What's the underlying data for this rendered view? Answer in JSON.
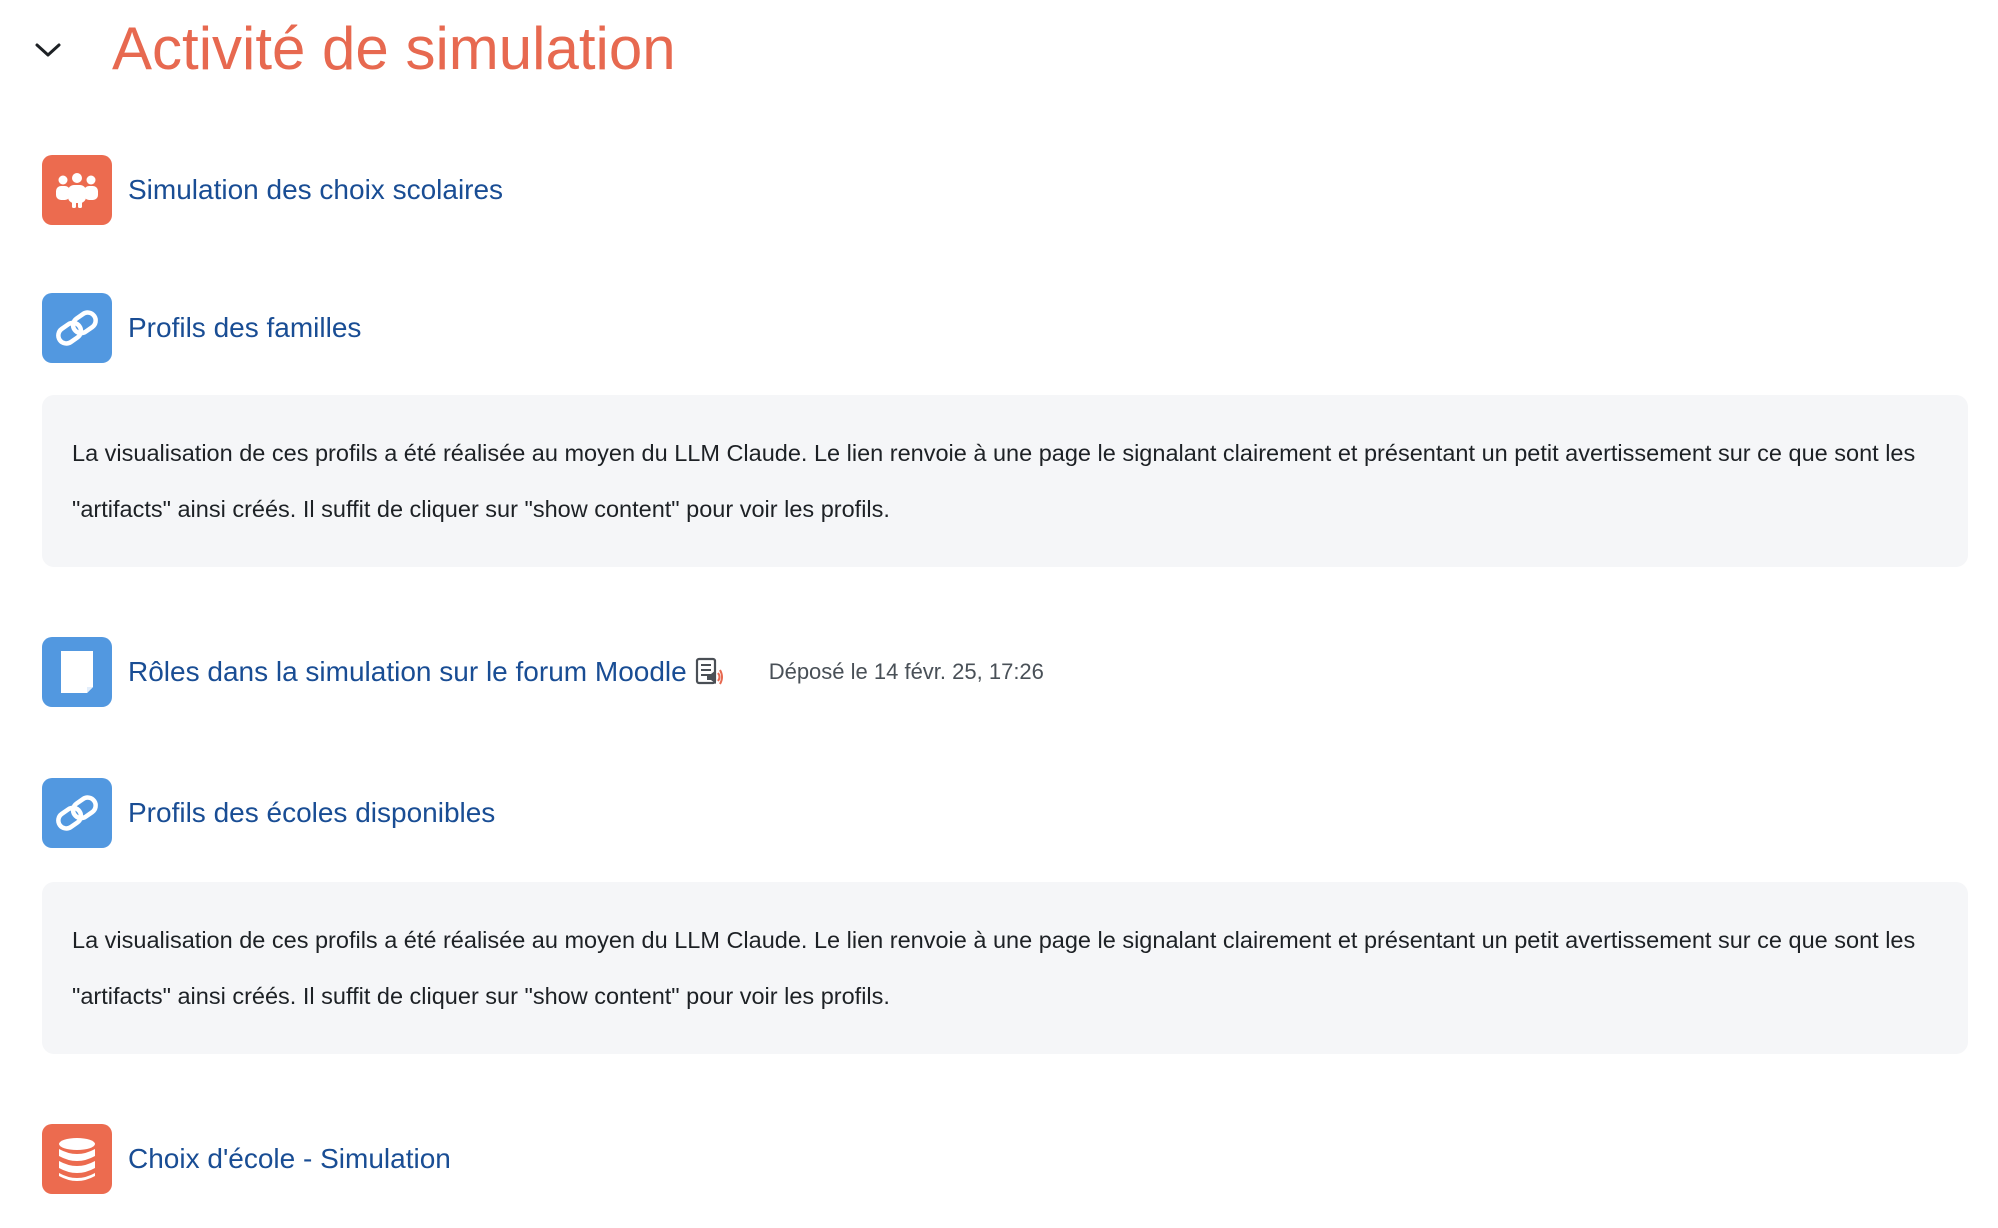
{
  "section": {
    "title": "Activité de simulation",
    "toggle_icon": "chevron-down-icon"
  },
  "activities": [
    {
      "type": "workshop",
      "icon": "group-people-icon",
      "icon_color": "#ec6b4f",
      "label": "Simulation des choix scolaires"
    },
    {
      "type": "url",
      "icon": "link-icon",
      "icon_color": "#5298e0",
      "label": "Profils des familles",
      "description": "La visualisation de ces profils a été réalisée au moyen du LLM Claude. Le lien renvoie à une page le signalant clairement et présentant un petit avertissement sur ce que sont les \"artifacts\" ainsi créés. Il suffit de cliquer sur \"show content\" pour voir les profils."
    },
    {
      "type": "page",
      "icon": "document-icon",
      "icon_color": "#5298e0",
      "label": "Rôles dans la simulation sur le forum Moodle",
      "trailing_icon": "forum-speaker-icon",
      "date_text": "Déposé le 14 févr. 25, 17:26"
    },
    {
      "type": "url",
      "icon": "link-icon",
      "icon_color": "#5298e0",
      "label": "Profils des écoles disponibles",
      "description": "La visualisation de ces profils a été réalisée au moyen du LLM Claude. Le lien renvoie à une page le signalant clairement et présentant un petit avertissement sur ce que sont les \"artifacts\" ainsi créés. Il suffit de cliquer sur \"show content\" pour voir les profils."
    },
    {
      "type": "database",
      "icon": "database-icon",
      "icon_color": "#ec6b4f",
      "label": "Choix d'école - Simulation"
    }
  ],
  "colors": {
    "title": "#e76950",
    "link": "#194d94",
    "description_bg": "#f5f6f8"
  }
}
